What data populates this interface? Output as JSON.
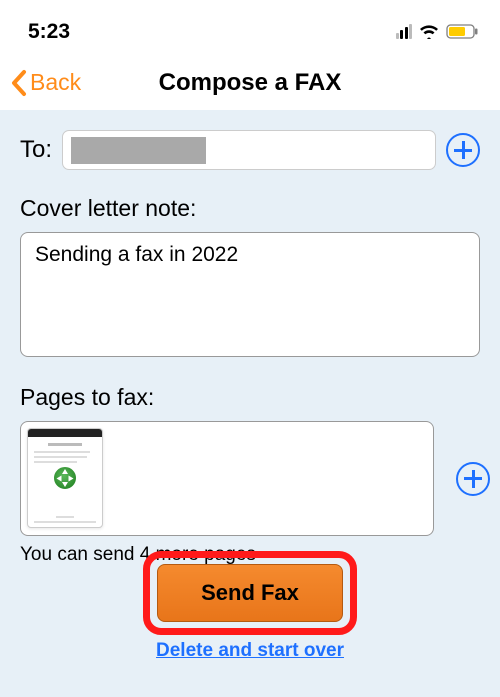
{
  "status": {
    "time": "5:23"
  },
  "nav": {
    "back_label": "Back",
    "title": "Compose a FAX"
  },
  "to": {
    "label": "To:"
  },
  "cover": {
    "label": "Cover letter note:",
    "value": "Sending a fax in 2022"
  },
  "pages": {
    "label": "Pages to fax:",
    "limit_text": "You can send 4 more pages"
  },
  "actions": {
    "send_label": "Send Fax",
    "delete_label": "Delete and start over"
  }
}
